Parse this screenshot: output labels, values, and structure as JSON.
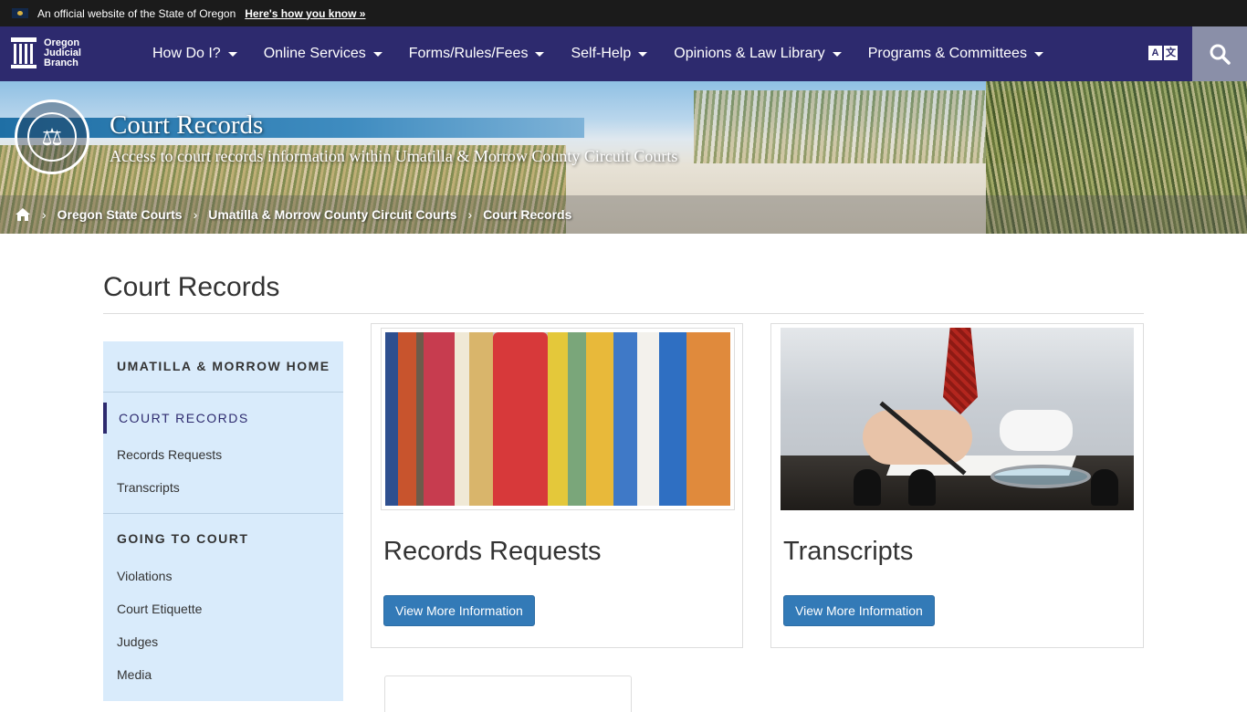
{
  "official_banner": {
    "text": "An official website of the State of Oregon",
    "link": "Here's how you know »"
  },
  "navbar": {
    "brand": "Oregon Judicial Branch",
    "items": [
      {
        "label": "How Do I?"
      },
      {
        "label": "Online Services"
      },
      {
        "label": "Forms/Rules/Fees"
      },
      {
        "label": "Self-Help"
      },
      {
        "label": "Opinions & Law Library"
      },
      {
        "label": "Programs & Committees"
      }
    ],
    "translate_icon": "translate-icon",
    "search_icon": "search-icon"
  },
  "hero": {
    "title": "Court Records",
    "subtitle": "Access to court records information within Umatilla & Morrow County Circuit Courts",
    "breadcrumb": [
      "Oregon State Courts",
      "Umatilla & Morrow County Circuit Courts",
      "Court Records"
    ]
  },
  "page": {
    "title": "Court Records"
  },
  "sidebar": {
    "home": "UMATILLA & MORROW HOME",
    "active_section": "COURT RECORDS",
    "records_links": [
      "Records Requests",
      "Transcripts"
    ],
    "second_section": "GOING TO COURT",
    "court_links": [
      "Violations",
      "Court Etiquette",
      "Judges",
      "Media"
    ]
  },
  "cards": [
    {
      "title": "Records Requests",
      "button": "View More Information"
    },
    {
      "title": "Transcripts",
      "button": "View More Information"
    }
  ],
  "colors": {
    "navbar": "#2d2a6e",
    "button": "#337ab7",
    "sidebar": "#d9ebfb"
  }
}
